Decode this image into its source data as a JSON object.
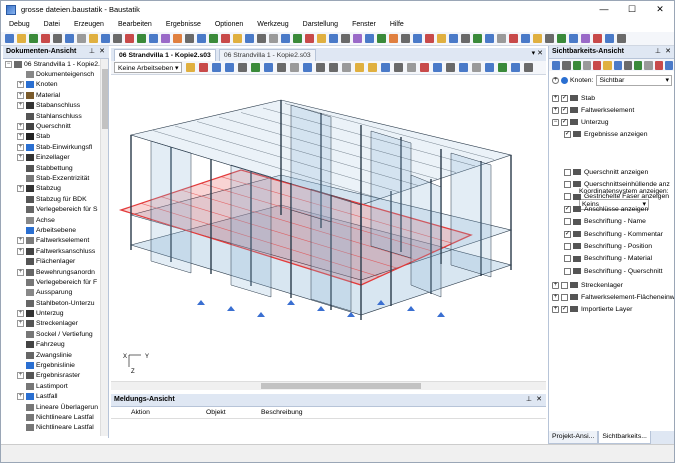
{
  "window": {
    "title": "grosse dateien.baustatik - Baustatik",
    "minimize": "—",
    "maximize": "☐",
    "close": "✕"
  },
  "menu": [
    "Debug",
    "Datei",
    "Erzeugen",
    "Bearbeiten",
    "Ergebnisse",
    "Optionen",
    "Werkzeug",
    "Darstellung",
    "Fenster",
    "Hilfe"
  ],
  "left_panel": {
    "title": "Dokumenten-Ansicht",
    "pin": "⊥",
    "close": "✕",
    "items": [
      {
        "label": "06 Strandvilla 1 - Kopie2.s03",
        "expander": "−",
        "icon_color": "#6a6a6a"
      },
      {
        "label": "Dokumenteigensch",
        "expander": "",
        "icon_color": "#888888"
      },
      {
        "label": "Knoten",
        "expander": "+",
        "icon_color": "#2a6fd1"
      },
      {
        "label": "Material",
        "expander": "+",
        "icon_color": "#7a5a2a"
      },
      {
        "label": "Stabanschluss",
        "expander": "+",
        "icon_color": "#333333"
      },
      {
        "label": "Stahlanschluss",
        "expander": "",
        "icon_color": "#555555"
      },
      {
        "label": "Querschnitt",
        "expander": "+",
        "icon_color": "#444444"
      },
      {
        "label": "Stab",
        "expander": "+",
        "icon_color": "#222222"
      },
      {
        "label": "Stab-Einwirkungsfl",
        "expander": "+",
        "icon_color": "#2a6fd1"
      },
      {
        "label": "Einzellager",
        "expander": "+",
        "icon_color": "#333333"
      },
      {
        "label": "Stabbettung",
        "expander": "",
        "icon_color": "#555555"
      },
      {
        "label": "Stab-Exzentrizität",
        "expander": "",
        "icon_color": "#777777"
      },
      {
        "label": "Stabzug",
        "expander": "+",
        "icon_color": "#333333"
      },
      {
        "label": "Stabzug für BDK",
        "expander": "",
        "icon_color": "#555555"
      },
      {
        "label": "Verlegebereich für S",
        "expander": "",
        "icon_color": "#666666"
      },
      {
        "label": "Achse",
        "expander": "",
        "icon_color": "#888888"
      },
      {
        "label": "Arbeitsebene",
        "expander": "",
        "icon_color": "#2a6fd1"
      },
      {
        "label": "Faltwerkselement",
        "expander": "+",
        "icon_color": "#7a7a7a"
      },
      {
        "label": "Faltwerksanschluss",
        "expander": "+",
        "icon_color": "#444444"
      },
      {
        "label": "Flächenlager",
        "expander": "",
        "icon_color": "#555555"
      },
      {
        "label": "Bewehrungsanordn",
        "expander": "+",
        "icon_color": "#666666"
      },
      {
        "label": "Verlegebereich für F",
        "expander": "",
        "icon_color": "#777777"
      },
      {
        "label": "Aussparung",
        "expander": "",
        "icon_color": "#888888"
      },
      {
        "label": "Stahlbeton-Unterzu",
        "expander": "",
        "icon_color": "#666666"
      },
      {
        "label": "Unterzug",
        "expander": "+",
        "icon_color": "#333333"
      },
      {
        "label": "Streckenlager",
        "expander": "+",
        "icon_color": "#555555"
      },
      {
        "label": "Sockel / Vertiefung",
        "expander": "",
        "icon_color": "#777777"
      },
      {
        "label": "Fahrzeug",
        "expander": "",
        "icon_color": "#444444"
      },
      {
        "label": "Zwangslinie",
        "expander": "",
        "icon_color": "#666666"
      },
      {
        "label": "Ergebnislinie",
        "expander": "",
        "icon_color": "#2a6fd1"
      },
      {
        "label": "Ergebnisraster",
        "expander": "+",
        "icon_color": "#555555"
      },
      {
        "label": "Lastimport",
        "expander": "",
        "icon_color": "#777777"
      },
      {
        "label": "Lastfall",
        "expander": "+",
        "icon_color": "#2a6fd1"
      },
      {
        "label": "Lineare Überlagerun",
        "expander": "",
        "icon_color": "#777777"
      },
      {
        "label": "Nichtlineare Lastfal",
        "expander": "",
        "icon_color": "#777777"
      },
      {
        "label": "Nichtlineare Lastfal",
        "expander": "",
        "icon_color": "#777777"
      }
    ]
  },
  "tabs": [
    {
      "label": "06 Strandvilla 1 - Kopie2.s03",
      "active": true
    },
    {
      "label": "06 Strandvilla 1 - Kopie2.s03",
      "active": false
    }
  ],
  "tab_controls": "▾ ✕",
  "doc_toolbar": {
    "workspace_dropdown": "Keine Arbeitseben ▾"
  },
  "viewport": {
    "axis_labels": {
      "x": "X",
      "y": "Y",
      "z": "Z"
    },
    "highlight_color": "#e33a3a",
    "structure_color": "#2a3a4a",
    "glass_color": "#8fb7d6"
  },
  "message_panel": {
    "title": "Meldungs-Ansicht",
    "pin": "⊥",
    "close": "✕",
    "columns": [
      "Aktion",
      "Objekt",
      "Beschreibung"
    ]
  },
  "right_panel": {
    "title": "Sichtbarkeits-Ansicht",
    "pin": "⊥",
    "close": "✕",
    "filter_label": "Knoten:",
    "filter_value": "Sichtbar",
    "items": [
      {
        "label": "Stab",
        "expander": "+",
        "checked": true,
        "indent": 0
      },
      {
        "label": "Faltwerkselement",
        "expander": "+",
        "checked": true,
        "indent": 0
      },
      {
        "label": "Unterzug",
        "expander": "−",
        "checked": true,
        "indent": 0
      },
      {
        "label": "Ergebnisse anzeigen",
        "expander": "",
        "checked": true,
        "indent": 1
      }
    ],
    "koord_label": "Koordinatensystem anzeigen:",
    "koord_value": "Keins",
    "sub_items": [
      {
        "label": "Querschnitt anzeigen",
        "checked": false
      },
      {
        "label": "Querschnittseinhüllende anz",
        "checked": false
      },
      {
        "label": "Gestrichelte Faser anzeigen",
        "checked": false
      },
      {
        "label": "Anschlüsse anzeigen",
        "checked": true
      },
      {
        "label": "Beschriftung - Name",
        "checked": false
      },
      {
        "label": "Beschriftung - Kommentar",
        "checked": true
      },
      {
        "label": "Beschriftung - Position",
        "checked": false
      },
      {
        "label": "Beschriftung - Material",
        "checked": false
      },
      {
        "label": "Beschriftung - Querschnitt",
        "checked": false
      }
    ],
    "bottom_items": [
      {
        "label": "Streckenlager",
        "expander": "+",
        "checked": false
      },
      {
        "label": "Faltwerkselement-Flächeneinw",
        "expander": "+",
        "checked": false
      },
      {
        "label": "Importierte Layer",
        "expander": "+",
        "checked": true
      }
    ]
  },
  "bottom_tabs": [
    {
      "label": "Projekt-Ansi...",
      "active": false
    },
    {
      "label": "Sichtbarkeits...",
      "active": true
    }
  ]
}
